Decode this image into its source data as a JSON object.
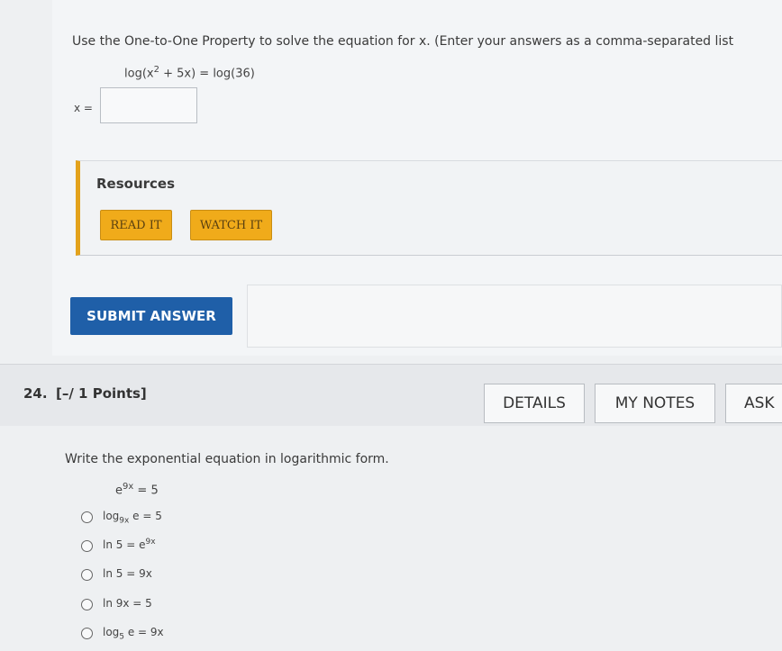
{
  "question23": {
    "prompt": "Use the One-to-One Property to solve the equation for x. (Enter your answers as a comma-separated list",
    "equation": {
      "left_pre": "log(x",
      "left_exp": "2",
      "left_post": " + 5x) = log(36)"
    },
    "answer_label": "x =",
    "answer_value": ""
  },
  "resources": {
    "title": "Resources",
    "read_label": "READ IT",
    "watch_label": "WATCH IT"
  },
  "submit_label": "SUBMIT ANSWER",
  "question24": {
    "number": "24.",
    "points": "[–/ 1 Points]",
    "details_label": "DETAILS",
    "notes_label": "MY NOTES",
    "ask_label": "ASK",
    "prompt": "Write the exponential equation in logarithmic form.",
    "equation": {
      "base": "e",
      "exp": "9x",
      "rest": " = 5"
    },
    "options": [
      {
        "pre": "log",
        "sub": "9x",
        "sup": "",
        "post": " e = 5"
      },
      {
        "pre": "ln 5 = e",
        "sub": "",
        "sup": "9x",
        "post": ""
      },
      {
        "pre": "ln 5 = 9x",
        "sub": "",
        "sup": "",
        "post": ""
      },
      {
        "pre": "ln 9x = 5",
        "sub": "",
        "sup": "",
        "post": ""
      },
      {
        "pre": "log",
        "sub": "5",
        "sup": "",
        "post": " e = 9x"
      }
    ]
  }
}
